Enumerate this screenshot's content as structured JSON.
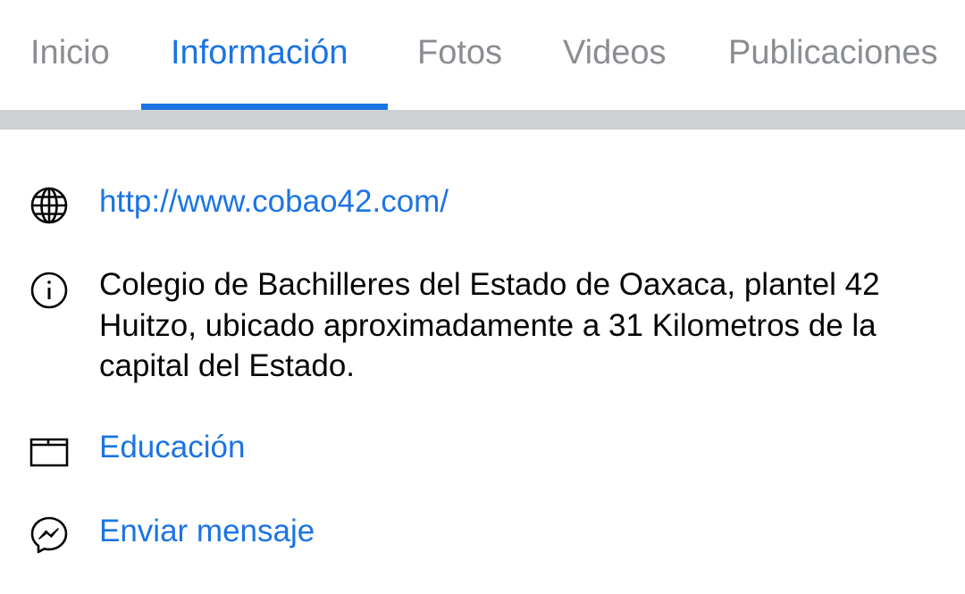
{
  "tabs": [
    {
      "label": "Inicio",
      "active": false
    },
    {
      "label": "Información",
      "active": true
    },
    {
      "label": "Fotos",
      "active": false
    },
    {
      "label": "Videos",
      "active": false
    },
    {
      "label": "Publicaciones",
      "active": false
    }
  ],
  "info": {
    "website": {
      "icon": "globe-icon",
      "text": "http://www.cobao42.com/"
    },
    "about": {
      "icon": "info-icon",
      "text": "Colegio de Bachilleres del Estado de Oaxaca, plantel 42 Huitzo, ubicado aproximadamente a 31 Kilometros de la capital del Estado."
    },
    "category": {
      "icon": "category-icon",
      "text": "Educación"
    },
    "message": {
      "icon": "messenger-icon",
      "text": "Enviar mensaje"
    }
  },
  "colors": {
    "accent": "#1b74e4",
    "inactive_tab": "#8a8d91",
    "text": "#050505",
    "divider": "#ced0d4"
  }
}
